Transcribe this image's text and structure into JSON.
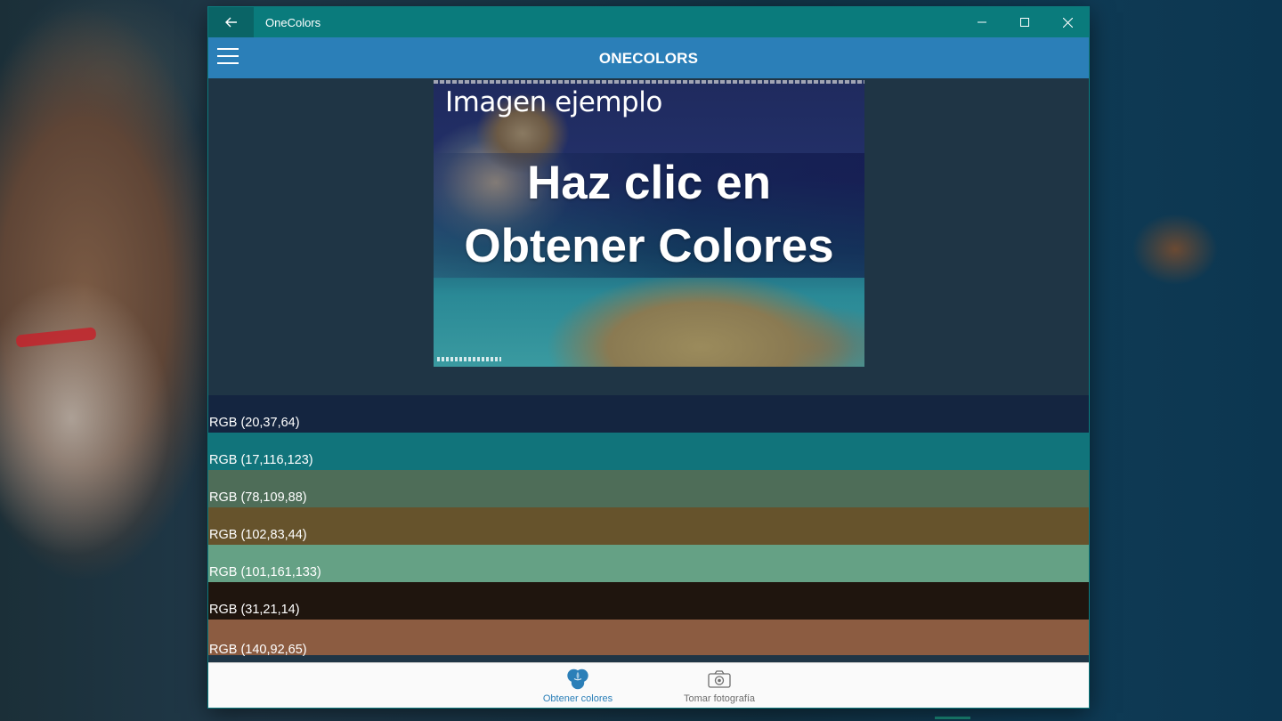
{
  "window": {
    "title": "OneColors",
    "icons": {
      "back": "arrow-left-icon",
      "minimize": "minimize-icon",
      "maximize": "maximize-icon",
      "close": "close-icon"
    }
  },
  "appbar": {
    "title": "ONECOLORS",
    "menu_icon": "hamburger-menu-icon"
  },
  "sample_image": {
    "caption": "Imagen ejemplo",
    "overlay_line1": "Haz clic en",
    "overlay_line2": "Obtener Colores"
  },
  "colors": [
    {
      "label": "RGB (20,37,64)",
      "hex": "#142540"
    },
    {
      "label": "RGB (17,116,123)",
      "hex": "#11747b"
    },
    {
      "label": "RGB (78,109,88)",
      "hex": "#4e6d58"
    },
    {
      "label": "RGB (102,83,44)",
      "hex": "#66532c"
    },
    {
      "label": "RGB (101,161,133)",
      "hex": "#65a185"
    },
    {
      "label": "RGB (31,21,14)",
      "hex": "#1f150e"
    },
    {
      "label": "RGB (140,92,65)",
      "hex": "#8c5c41"
    }
  ],
  "bottom_nav": {
    "items": [
      {
        "label": "Obtener colores",
        "icon": "color-circles-icon",
        "active": true
      },
      {
        "label": "Tomar fotografía",
        "icon": "camera-icon",
        "active": false
      }
    ]
  },
  "theme": {
    "titlebar": "#0a7b7c",
    "appbar": "#2b7fb8",
    "content_bg": "#1f3545",
    "accent": "#2b7fb8"
  }
}
